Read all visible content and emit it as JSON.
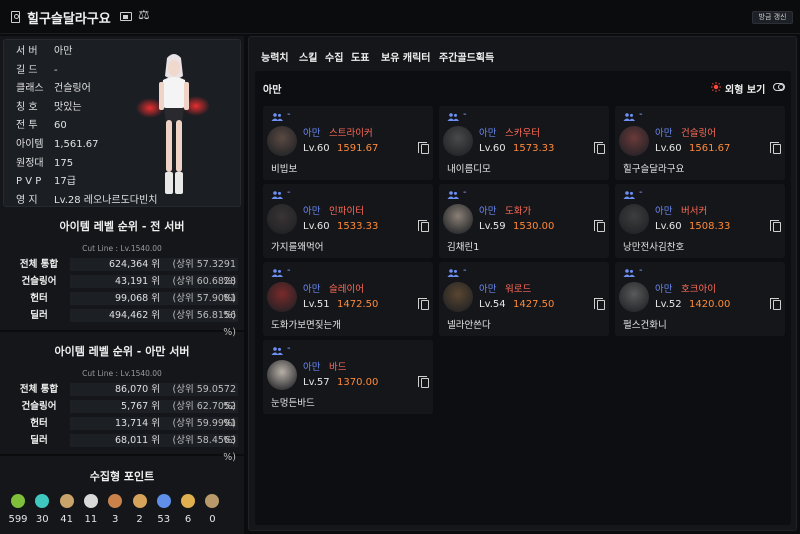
{
  "header": {
    "title": "힐구슬달라구요",
    "refresh_label": "방금 갱신"
  },
  "profile": {
    "rows": [
      {
        "key": "서 버",
        "value": "아만"
      },
      {
        "key": "길 드",
        "value": "-"
      },
      {
        "key": "클래스",
        "value": "건슬링어"
      },
      {
        "key": "칭 호",
        "value": "맛있는"
      },
      {
        "key": "전 투",
        "value": "60"
      },
      {
        "key": "아이템",
        "value": "1,561.67"
      },
      {
        "key": "원정대",
        "value": "175"
      },
      {
        "key": "P V P",
        "value": "17급"
      },
      {
        "key": "영 지",
        "value": "Lv.28 레오나르도다빈치"
      }
    ]
  },
  "ranking_all": {
    "title": "아이템 레벨 순위 - 전 서버",
    "cutline": "Cut Line : Lv.1540.00",
    "rows": [
      {
        "cls": "전체 통합",
        "rank": "624,364 위",
        "pct": "(상위 57.3291 %)"
      },
      {
        "cls": "건슬링어",
        "rank": "43,191 위",
        "pct": "(상위 60.6828 %)"
      },
      {
        "cls": "헌터",
        "rank": "99,068 위",
        "pct": "(상위 57.9081 %)"
      },
      {
        "cls": "딜러",
        "rank": "494,462 위",
        "pct": "(상위 56.8156 %)"
      }
    ]
  },
  "ranking_server": {
    "title": "아이템 레벨 순위 - 아만 서버",
    "cutline": "Cut Line : Lv.1540.00",
    "rows": [
      {
        "cls": "전체 통합",
        "rank": "86,070 위",
        "pct": "(상위 59.0572 %)"
      },
      {
        "cls": "건슬링어",
        "rank": "5,767 위",
        "pct": "(상위 62.7052 %)"
      },
      {
        "cls": "헌터",
        "rank": "13,714 위",
        "pct": "(상위 59.9991 %)"
      },
      {
        "cls": "딜러",
        "rank": "68,011 위",
        "pct": "(상위 58.4563 %)"
      }
    ]
  },
  "collect": {
    "title": "수집형 포인트",
    "items": [
      {
        "icon": "mokoko-seed-icon",
        "value": "599",
        "color": "#7fbf3a"
      },
      {
        "icon": "island-heart-icon",
        "value": "30",
        "color": "#3fc8c0"
      },
      {
        "icon": "great-art-icon",
        "value": "41",
        "color": "#c9a46a"
      },
      {
        "icon": "giant-heart-icon",
        "value": "11",
        "color": "#d9d9d9"
      },
      {
        "icon": "ignea-token-icon",
        "value": "3",
        "color": "#c9824a"
      },
      {
        "icon": "sea-bounty-icon",
        "value": "2",
        "color": "#d6a35a"
      },
      {
        "icon": "world-tree-leaf-icon",
        "value": "53",
        "color": "#5f8fe8"
      },
      {
        "icon": "orpheus-star-icon",
        "value": "6",
        "color": "#e0b050"
      },
      {
        "icon": "orgel-icon",
        "value": "0",
        "color": "#b89a6a"
      }
    ]
  },
  "tabs": [
    "능력치",
    "스킬",
    "수집",
    "도표",
    "보유 캐릭터",
    "주간골드획득"
  ],
  "roster": {
    "server": "아만",
    "look_label": "외형 보기",
    "party_dash": "-",
    "characters": [
      {
        "server": "아만",
        "cls": "스트라이커",
        "lv": "Lv.60",
        "ilv": "1591.67",
        "nick": "비빕보",
        "avatar_color": "#5a4a42"
      },
      {
        "server": "아만",
        "cls": "스카우터",
        "lv": "Lv.60",
        "ilv": "1573.33",
        "nick": "내이름디모",
        "avatar_color": "#4a4a4a"
      },
      {
        "server": "아만",
        "cls": "건슬링어",
        "lv": "Lv.60",
        "ilv": "1561.67",
        "nick": "힐구슬달라구요",
        "avatar_color": "#6a3a3a"
      },
      {
        "server": "아만",
        "cls": "인파이터",
        "lv": "Lv.60",
        "ilv": "1533.33",
        "nick": "가지를왜먹어",
        "avatar_color": "#3a3434"
      },
      {
        "server": "아만",
        "cls": "도화가",
        "lv": "Lv.59",
        "ilv": "1530.00",
        "nick": "김채린1",
        "avatar_color": "#8a8076"
      },
      {
        "server": "아만",
        "cls": "버서커",
        "lv": "Lv.60",
        "ilv": "1508.33",
        "nick": "낭만전사김찬호",
        "avatar_color": "#3e3e3e"
      },
      {
        "server": "아만",
        "cls": "슬레이어",
        "lv": "Lv.51",
        "ilv": "1472.50",
        "nick": "도화가보면짖는개",
        "avatar_color": "#7a2a2a"
      },
      {
        "server": "아만",
        "cls": "워로드",
        "lv": "Lv.54",
        "ilv": "1427.50",
        "nick": "넬라안쓴다",
        "avatar_color": "#5a4630"
      },
      {
        "server": "아만",
        "cls": "호크아이",
        "lv": "Lv.52",
        "ilv": "1420.00",
        "nick": "펄스건화니",
        "avatar_color": "#5a5a5a"
      },
      {
        "server": "아만",
        "cls": "바드",
        "lv": "Lv.57",
        "ilv": "1370.00",
        "nick": "눈멍든바드",
        "avatar_color": "#b8b0a8"
      }
    ]
  }
}
